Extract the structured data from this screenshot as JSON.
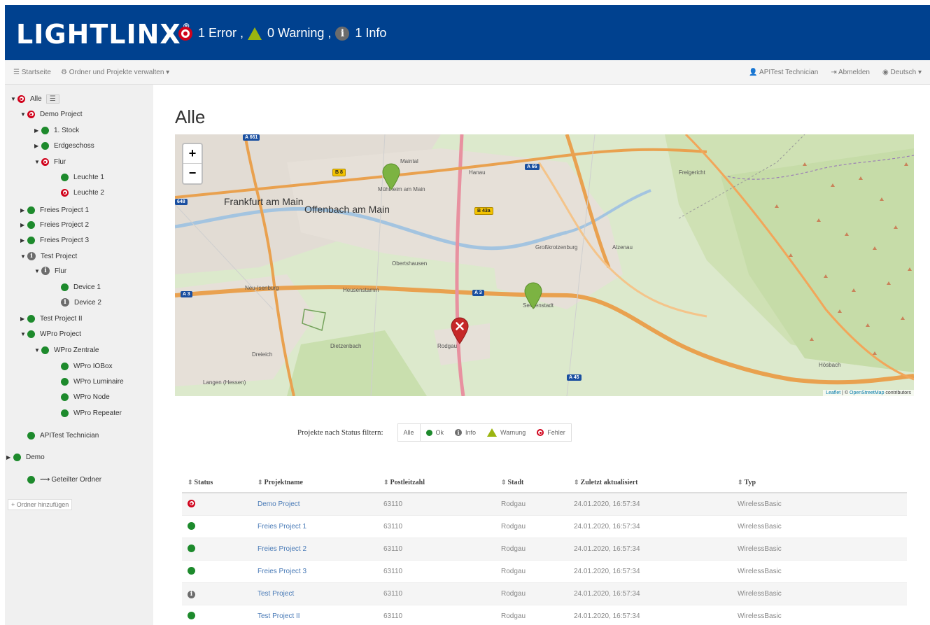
{
  "header": {
    "logo": "LIGHTLINX",
    "logo_mark": "®",
    "error_text": "1 Error ,",
    "warning_text": "0 Warning ,",
    "info_text": "1 Info"
  },
  "subnav": {
    "home": "Startseite",
    "manage": "Ordner und Projekte verwalten ▾",
    "user": "APITest Technician",
    "logout": "Abmelden",
    "language": "Deutsch ▾"
  },
  "tree": [
    {
      "label": "Alle",
      "status": "error",
      "caret": "▼"
    },
    {
      "label": "Demo Project",
      "status": "error",
      "caret": "▼"
    },
    {
      "label": "1. Stock",
      "status": "ok",
      "caret": "▶"
    },
    {
      "label": "Erdgeschoss",
      "status": "ok",
      "caret": "▶"
    },
    {
      "label": "Flur",
      "status": "error",
      "caret": "▼"
    },
    {
      "label": "Leuchte 1",
      "status": "ok",
      "caret": ""
    },
    {
      "label": "Leuchte 2",
      "status": "error",
      "caret": ""
    },
    {
      "label": "Freies Project 1",
      "status": "ok",
      "caret": "▶"
    },
    {
      "label": "Freies Project 2",
      "status": "ok",
      "caret": "▶"
    },
    {
      "label": "Freies Project 3",
      "status": "ok",
      "caret": "▶"
    },
    {
      "label": "Test Project",
      "status": "info",
      "caret": "▼"
    },
    {
      "label": "Flur",
      "status": "info",
      "caret": "▼"
    },
    {
      "label": "Device 1",
      "status": "ok",
      "caret": ""
    },
    {
      "label": "Device 2",
      "status": "info",
      "caret": ""
    },
    {
      "label": "Test Project II",
      "status": "ok",
      "caret": "▶"
    },
    {
      "label": "WPro Project",
      "status": "ok",
      "caret": "▼"
    },
    {
      "label": "WPro Zentrale",
      "status": "ok",
      "caret": "▼"
    },
    {
      "label": "WPro IOBox",
      "status": "ok",
      "caret": ""
    },
    {
      "label": "WPro Luminaire",
      "status": "ok",
      "caret": ""
    },
    {
      "label": "WPro Node",
      "status": "ok",
      "caret": ""
    },
    {
      "label": "WPro Repeater",
      "status": "ok",
      "caret": ""
    },
    {
      "label": "APITest Technician",
      "status": "ok",
      "caret": ""
    },
    {
      "label": "Demo",
      "status": "ok",
      "caret": "▶"
    },
    {
      "label": "Geteilter Ordner",
      "status": "ok",
      "caret": ""
    }
  ],
  "add_folder": "+ Ordner hinzufügen",
  "page_title": "Alle",
  "map": {
    "attribution_leaflet": "Leaflet",
    "attribution_sep": " | © ",
    "attribution_osm": "OpenStreetMap",
    "attribution_tail": " contributors",
    "labels": {
      "frankfurt": "Frankfurt am Main",
      "offenbach": "Offenbach am Main",
      "maintal": "Maintal",
      "hanau": "Hanau",
      "muehlheim": "Mühlheim am Main",
      "freigericht": "Freigericht",
      "grosskrotzenburg": "Großkrotzenburg",
      "alzenau": "Alzenau",
      "obertshausen": "Obertshausen",
      "neuisenburg": "Neu-Isenburg",
      "heusenstamm": "Heusenstamm",
      "seligenstadt": "Seligenstadt",
      "dietzenbach": "Dietzenbach",
      "dreieich": "Dreieich",
      "rodgau": "Rodgau",
      "langen": "Langen (Hessen)",
      "hoesbach": "Hösbach"
    },
    "shields": {
      "a661": "A 661",
      "a66": "A 66",
      "a648": "648",
      "a3w": "A 3",
      "a3e": "A 3",
      "a45": "A 45",
      "b8": "B 8",
      "b43a": "B 43a"
    }
  },
  "filter": {
    "label": "Projekte nach Status filtern:",
    "all": "Alle",
    "ok": "Ok",
    "info": "Info",
    "warning": "Warnung",
    "error": "Fehler"
  },
  "table": {
    "headers": [
      "Status",
      "Projektname",
      "Postleitzahl",
      "Stadt",
      "Zuletzt aktualisiert",
      "Typ"
    ],
    "rows": [
      {
        "status": "error",
        "name": "Demo Project",
        "zip": "63110",
        "city": "Rodgau",
        "updated": "24.01.2020, 16:57:34",
        "type": "WirelessBasic"
      },
      {
        "status": "ok",
        "name": "Freies Project 1",
        "zip": "63110",
        "city": "Rodgau",
        "updated": "24.01.2020, 16:57:34",
        "type": "WirelessBasic"
      },
      {
        "status": "ok",
        "name": "Freies Project 2",
        "zip": "63110",
        "city": "Rodgau",
        "updated": "24.01.2020, 16:57:34",
        "type": "WirelessBasic"
      },
      {
        "status": "ok",
        "name": "Freies Project 3",
        "zip": "63110",
        "city": "Rodgau",
        "updated": "24.01.2020, 16:57:34",
        "type": "WirelessBasic"
      },
      {
        "status": "info",
        "name": "Test Project",
        "zip": "63110",
        "city": "Rodgau",
        "updated": "24.01.2020, 16:57:34",
        "type": "WirelessBasic"
      },
      {
        "status": "ok",
        "name": "Test Project II",
        "zip": "63110",
        "city": "Rodgau",
        "updated": "24.01.2020, 16:57:34",
        "type": "WirelessBasic"
      }
    ]
  },
  "colors": {
    "header_bg": "#00418f",
    "ok": "#1d8a2c",
    "error": "#d0021b",
    "info": "#6c6c6c",
    "warning": "#9bb510",
    "link": "#4a7bb7",
    "marker_ok": "#7cb342",
    "marker_error": "#c62828"
  }
}
